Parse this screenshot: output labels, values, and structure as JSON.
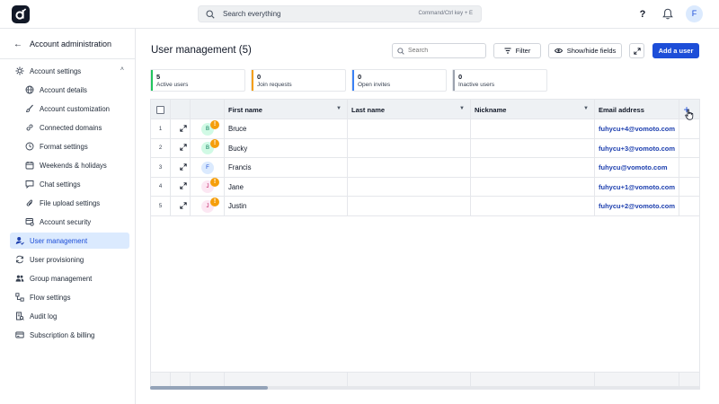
{
  "topbar": {
    "search_placeholder": "Search everything",
    "search_shortcut": "Command/Ctrl key + E",
    "help_label": "?",
    "avatar_initial": "F"
  },
  "sidebar": {
    "back_label": "Account administration",
    "items": [
      {
        "label": "Account settings",
        "icon": "gear-icon",
        "level": 0,
        "expanded": true
      },
      {
        "label": "Account details",
        "icon": "globe-icon",
        "level": 1
      },
      {
        "label": "Account customization",
        "icon": "brush-icon",
        "level": 1
      },
      {
        "label": "Connected domains",
        "icon": "link-icon",
        "level": 1
      },
      {
        "label": "Format settings",
        "icon": "clock-icon",
        "level": 1
      },
      {
        "label": "Weekends & holidays",
        "icon": "calendar-icon",
        "level": 1
      },
      {
        "label": "Chat settings",
        "icon": "chat-icon",
        "level": 1
      },
      {
        "label": "File upload settings",
        "icon": "paperclip-icon",
        "level": 1
      },
      {
        "label": "Account security",
        "icon": "lock-icon",
        "level": 1
      },
      {
        "label": "User management",
        "icon": "user-icon",
        "level": 0,
        "active": true
      },
      {
        "label": "User provisioning",
        "icon": "sync-icon",
        "level": 0
      },
      {
        "label": "Group management",
        "icon": "group-icon",
        "level": 0
      },
      {
        "label": "Flow settings",
        "icon": "flow-icon",
        "level": 0
      },
      {
        "label": "Audit log",
        "icon": "audit-icon",
        "level": 0
      },
      {
        "label": "Subscription & billing",
        "icon": "billing-icon",
        "level": 0
      }
    ]
  },
  "main": {
    "title": "User management (5)",
    "search_placeholder": "Search",
    "filter_label": "Filter",
    "show_hide_label": "Show/hide fields",
    "add_user_label": "Add a user",
    "stats": [
      {
        "value": "5",
        "label": "Active users",
        "color": "#22c55e"
      },
      {
        "value": "0",
        "label": "Join requests",
        "color": "#f59e0b"
      },
      {
        "value": "0",
        "label": "Open invites",
        "color": "#3b82f6"
      },
      {
        "value": "0",
        "label": "Inactive users",
        "color": "#9ca3af"
      }
    ]
  },
  "table": {
    "columns": [
      "First name",
      "Last name",
      "Nickname",
      "Email address"
    ],
    "add_column_label": "+",
    "rows": [
      {
        "num": "1",
        "initial": "B",
        "avatar_bg": "#d1fae5",
        "avatar_fg": "#047857",
        "warning": true,
        "first_name": "Bruce",
        "last_name": "",
        "nickname": "",
        "email": "fuhycu+4@vomoto.com"
      },
      {
        "num": "2",
        "initial": "B",
        "avatar_bg": "#d1fae5",
        "avatar_fg": "#047857",
        "warning": true,
        "first_name": "Bucky",
        "last_name": "",
        "nickname": "",
        "email": "fuhycu+3@vomoto.com"
      },
      {
        "num": "3",
        "initial": "F",
        "avatar_bg": "#dbeafe",
        "avatar_fg": "#1d4ed8",
        "warning": false,
        "first_name": "Francis",
        "last_name": "",
        "nickname": "",
        "email": "fuhycu@vomoto.com"
      },
      {
        "num": "4",
        "initial": "J",
        "avatar_bg": "#fce7f3",
        "avatar_fg": "#be185d",
        "warning": true,
        "first_name": "Jane",
        "last_name": "",
        "nickname": "",
        "email": "fuhycu+1@vomoto.com"
      },
      {
        "num": "5",
        "initial": "J",
        "avatar_bg": "#fce7f3",
        "avatar_fg": "#be185d",
        "warning": true,
        "first_name": "Justin",
        "last_name": "",
        "nickname": "",
        "email": "fuhycu+2@vomoto.com"
      }
    ],
    "warning_glyph": "!"
  },
  "colors": {
    "accent": "#1d4ed8",
    "active_nav_bg": "#dbeafe"
  }
}
